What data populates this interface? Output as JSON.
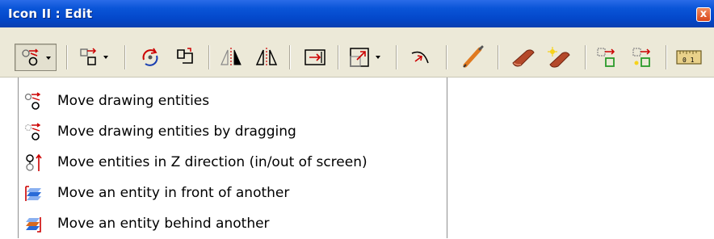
{
  "window": {
    "title": "Icon II : Edit",
    "close_label": "x"
  },
  "toolbar": {
    "buttons": [
      {
        "name": "move-entities-dropdown-button",
        "icon": "move-entities-icon",
        "has_dropdown": true,
        "pressed": true
      },
      {
        "name": "copy-entities-dropdown-button",
        "icon": "copy-entities-icon",
        "has_dropdown": true
      },
      {
        "name": "rotate-button",
        "icon": "rotate-icon"
      },
      {
        "name": "rotate-copy-button",
        "icon": "rotate-copy-icon"
      },
      {
        "name": "mirror-button",
        "icon": "mirror-icon"
      },
      {
        "name": "mirror-copy-button",
        "icon": "mirror-copy-icon"
      },
      {
        "name": "stretch-button",
        "icon": "stretch-icon"
      },
      {
        "name": "scale-dropdown-button",
        "icon": "scale-icon",
        "has_dropdown": true
      },
      {
        "name": "path-button",
        "icon": "path-icon"
      },
      {
        "name": "pen-button",
        "icon": "pen-icon"
      },
      {
        "name": "eraser-button",
        "icon": "eraser-icon"
      },
      {
        "name": "eraser-special-button",
        "icon": "eraser-sparkle-icon"
      },
      {
        "name": "select-group-button",
        "icon": "select-group-icon"
      },
      {
        "name": "select-group-add-button",
        "icon": "select-group-add-icon"
      },
      {
        "name": "measure-button",
        "icon": "ruler-icon"
      }
    ]
  },
  "menu": {
    "items": [
      {
        "label": "Move drawing entities",
        "icon": "move-entities-icon"
      },
      {
        "label": "Move drawing entities by dragging",
        "icon": "move-drag-icon"
      },
      {
        "label": "Move entities in Z direction (in/out of screen)",
        "icon": "move-z-icon"
      },
      {
        "label": "Move an entity in front of another",
        "icon": "bring-front-icon"
      },
      {
        "label": "Move an entity behind another",
        "icon": "send-back-icon"
      }
    ]
  },
  "colors": {
    "titlebar": "#0a55d8",
    "toolbar_bg": "#ece9d8",
    "close_button": "#d8471b"
  }
}
